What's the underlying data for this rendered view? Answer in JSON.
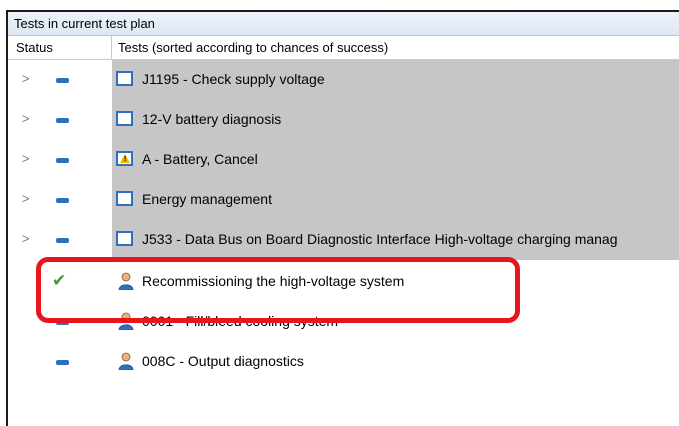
{
  "panel": {
    "title": "Tests in current test plan"
  },
  "columns": {
    "status": "Status",
    "tests": "Tests (sorted according to chances of success)"
  },
  "rows": [
    {
      "label": "J1195 -  Check supply voltage",
      "status": "pending",
      "icon": "document-icon",
      "expandable": true,
      "selected": true
    },
    {
      "label": "12-V battery diagnosis",
      "status": "pending",
      "icon": "document-icon",
      "expandable": true,
      "selected": true
    },
    {
      "label": "A - Battery, Cancel",
      "status": "pending",
      "icon": "warning-document-icon",
      "expandable": true,
      "selected": true
    },
    {
      "label": "Energy management",
      "status": "pending",
      "icon": "document-icon",
      "expandable": true,
      "selected": true
    },
    {
      "label": "J533 - Data Bus on Board Diagnostic Interface  High-voltage charging manag",
      "status": "pending",
      "icon": "document-icon",
      "expandable": true,
      "selected": true
    },
    {
      "label": "Recommissioning the high-voltage system",
      "status": "passed",
      "icon": "person-icon",
      "expandable": false,
      "selected": false
    },
    {
      "label": "0001 - Fill/bleed cooling system",
      "status": "pending",
      "icon": "person-icon",
      "expandable": false,
      "selected": false
    },
    {
      "label": "008C - Output diagnostics",
      "status": "pending",
      "icon": "person-icon",
      "expandable": false,
      "selected": false
    }
  ],
  "colors": {
    "highlight": "#e8151c",
    "selection_bg": "#c6c6c6",
    "status_pending": "#2f6fc0",
    "status_passed": "#3b9c2a"
  }
}
